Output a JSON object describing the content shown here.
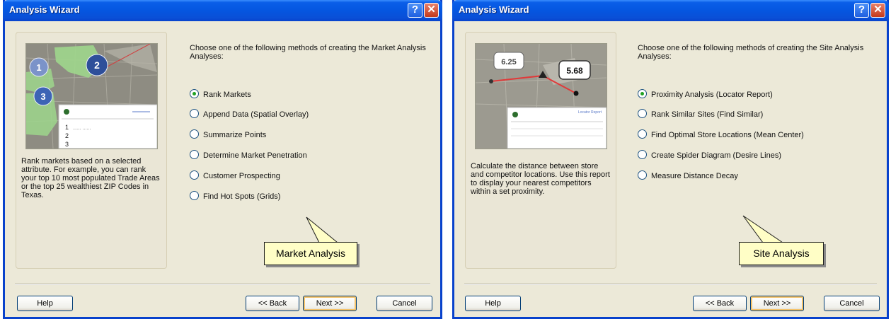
{
  "left": {
    "title": "Analysis Wizard",
    "help_glyph": "?",
    "close_glyph": "✕",
    "illustration": {
      "markers": [
        "1",
        "2",
        "3"
      ],
      "table_rows": [
        "1",
        "2",
        "3"
      ],
      "table_filler": "...... ......"
    },
    "description": "Rank markets based on a selected attribute. For example, you can rank your top 10 most populated Trade Areas or the top 25 wealthiest ZIP Codes in Texas.",
    "intro": "Choose one of the following methods of creating the Market Analysis Analyses:",
    "options": [
      {
        "label": "Rank Markets",
        "selected": true
      },
      {
        "label": "Append Data (Spatial Overlay)",
        "selected": false
      },
      {
        "label": "Summarize Points",
        "selected": false
      },
      {
        "label": "Determine Market Penetration",
        "selected": false
      },
      {
        "label": "Customer Prospecting",
        "selected": false
      },
      {
        "label": "Find Hot Spots (Grids)",
        "selected": false
      }
    ],
    "callout": "Market Analysis",
    "buttons": {
      "help": "Help",
      "back": "<< Back",
      "next": "Next >>",
      "cancel": "Cancel"
    }
  },
  "right": {
    "title": "Analysis Wizard",
    "help_glyph": "?",
    "close_glyph": "✕",
    "illustration": {
      "value_a": "6.25",
      "value_b": "5.68",
      "report_title": "Locator Report"
    },
    "description": "Calculate the distance between store and competitor locations. Use this report to display your nearest competitors within a set proximity.",
    "intro": "Choose one of the following methods of creating the Site Analysis Analyses:",
    "options": [
      {
        "label": "Proximity Analysis (Locator Report)",
        "selected": true
      },
      {
        "label": "Rank Similar Sites (Find Similar)",
        "selected": false
      },
      {
        "label": "Find Optimal Store Locations (Mean Center)",
        "selected": false
      },
      {
        "label": "Create Spider Diagram (Desire Lines)",
        "selected": false
      },
      {
        "label": "Measure Distance Decay",
        "selected": false
      }
    ],
    "callout": "Site Analysis",
    "buttons": {
      "help": "Help",
      "back": "<< Back",
      "next": "Next >>",
      "cancel": "Cancel"
    }
  },
  "colors": {
    "title_bar": "#0556e0",
    "dialog_bg": "#ece9d8",
    "callout_bg": "#fffec6",
    "radio_selected": "#21a121"
  }
}
